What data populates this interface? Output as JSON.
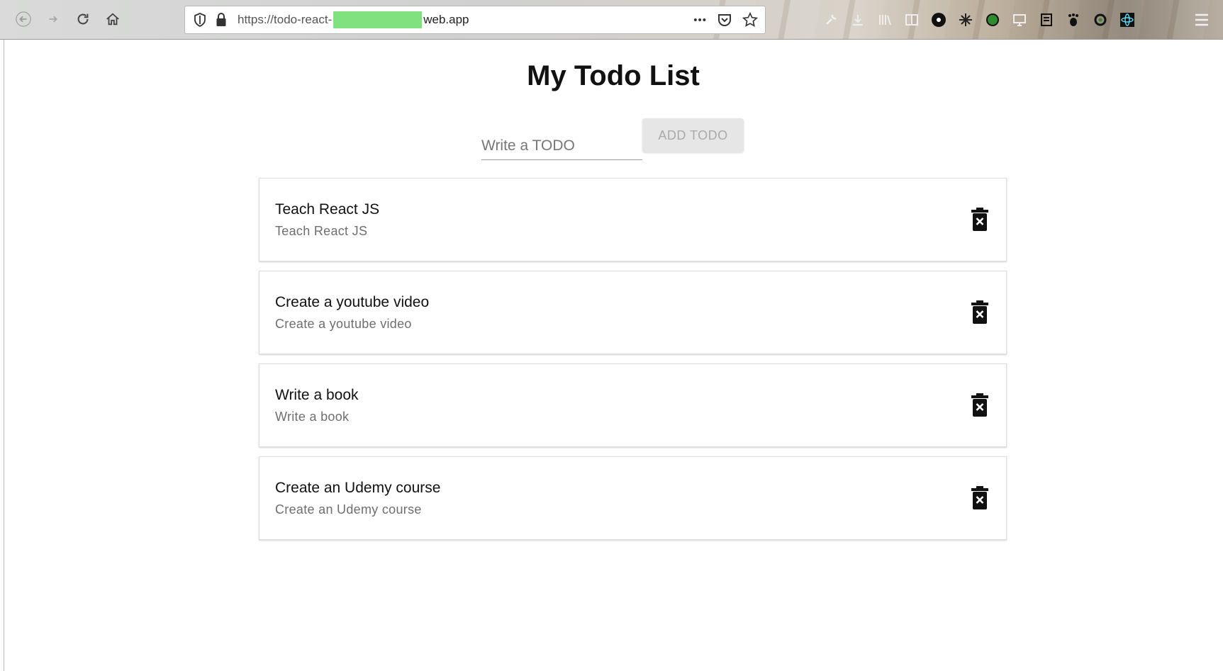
{
  "browser": {
    "url_prefix": "https://todo-react-",
    "url_suffix": "web.app",
    "more_label": "•••"
  },
  "page": {
    "title": "My Todo List",
    "input": {
      "placeholder": "Write a TODO",
      "value": ""
    },
    "add_button_label": "ADD TODO"
  },
  "todos": [
    {
      "primary": "Teach React JS",
      "secondary": "Teach React JS"
    },
    {
      "primary": "Create a youtube video",
      "secondary": "Create a youtube video"
    },
    {
      "primary": "Write a book",
      "secondary": "Write a book"
    },
    {
      "primary": "Create an Udemy course",
      "secondary": "Create an Udemy course"
    }
  ],
  "icons": {
    "back": "back-arrow-icon",
    "forward": "forward-arrow-icon",
    "reload": "reload-icon",
    "home": "home-icon",
    "shield": "shield-icon",
    "lock": "lock-icon",
    "pocket": "pocket-icon",
    "star": "star-icon",
    "delete": "delete-forever-icon",
    "menu": "hamburger-menu-icon"
  },
  "colors": {
    "redaction": "#7fe27f",
    "add_button_bg": "#e6e6e6",
    "add_button_text": "#aaaaaa"
  }
}
